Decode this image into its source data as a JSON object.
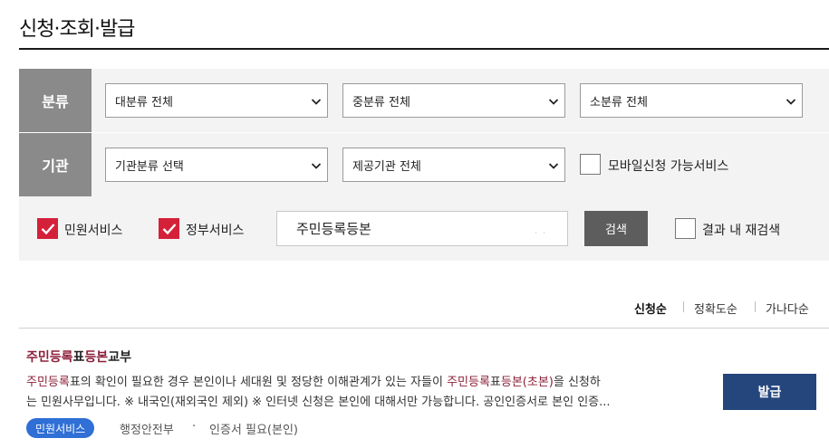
{
  "page": {
    "title": "신청·조회·발급"
  },
  "filters": {
    "category_label": "분류",
    "agency_label": "기관",
    "major_category": "대분류 전체",
    "middle_category": "중분류 전체",
    "minor_category": "소분류 전체",
    "agency_category": "기관분류 선택",
    "provider_agency": "제공기관 전체",
    "mobile_option": {
      "label": "모바일신청 가능서비스",
      "checked": false
    },
    "civil_service": {
      "label": "민원서비스",
      "checked": true
    },
    "gov_service": {
      "label": "정부서비스",
      "checked": true
    },
    "search_value": "주민등록등본",
    "search_dots": "· ·",
    "search_button": "검색",
    "research_option": {
      "label": "결과 내 재검색",
      "checked": false
    }
  },
  "sort": {
    "options": [
      "신청순",
      "정확도순",
      "가나다순"
    ],
    "active": "신청순"
  },
  "results": [
    {
      "title_parts": [
        "주민등록",
        "표",
        "등본",
        "교부"
      ],
      "desc_line1": [
        "주민등록",
        "표의 확인이 필요한 경우 본인이나 세대원 및 정당한 이해관계가 있는 자들이 ",
        "주민등록",
        "표",
        "등본(초본)",
        "을 신청하"
      ],
      "desc_line2": "는 민원사무입니다. ※ 내국인(재외국인 제외) ※ 인터넷 신청은 본인에 대해서만 가능합니다. 공인인증서로 본인 인증...",
      "badge": "민원서비스",
      "agency": "행정안전부",
      "meta_sep": "·",
      "auth": "인증서 필요(본인)",
      "action": "발급"
    }
  ],
  "colors": {
    "accent_red": "#d5203a",
    "issue_blue": "#25467d",
    "badge_blue": "#2f6fd6",
    "highlight": "#8c1f3a"
  }
}
